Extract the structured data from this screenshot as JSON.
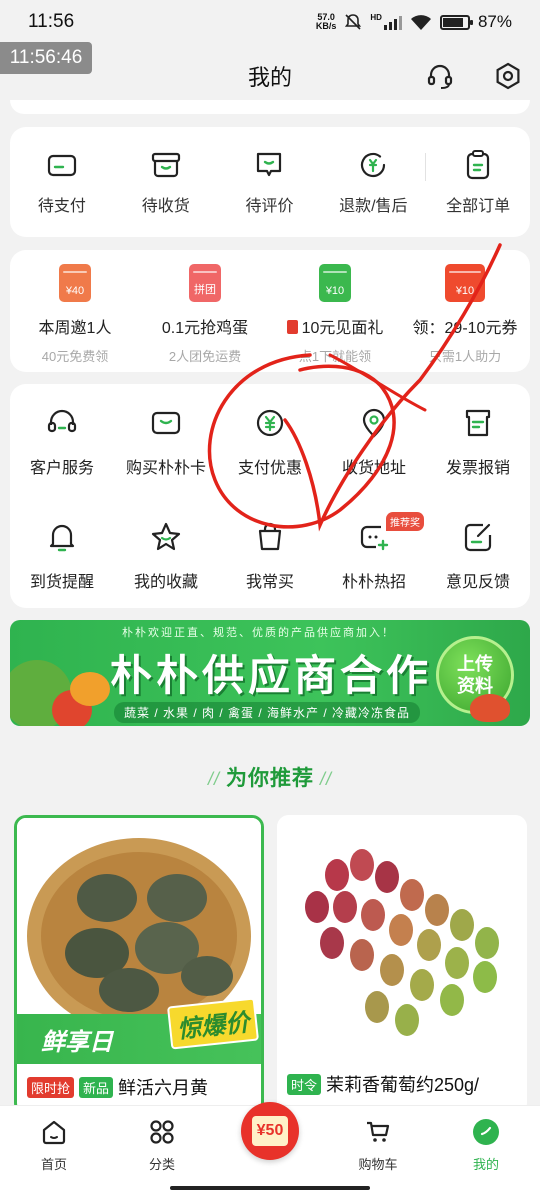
{
  "status_bar": {
    "time": "11:56",
    "net_speed_value": "57.0",
    "net_speed_unit": "KB/s",
    "network": "HD",
    "battery": "87%"
  },
  "clock_badge": "11:56:46",
  "header": {
    "title": "我的"
  },
  "orders": [
    {
      "label": "待支付",
      "icon": "card-icon"
    },
    {
      "label": "待收货",
      "icon": "box-icon"
    },
    {
      "label": "待评价",
      "icon": "chat-icon"
    },
    {
      "label": "退款/售后",
      "icon": "refund-icon"
    },
    {
      "label": "全部订单",
      "icon": "clipboard-icon"
    }
  ],
  "promos": [
    {
      "badge": "¥40",
      "title": "本周邀1人",
      "sub": "40元免费领",
      "color": "#f07a4a"
    },
    {
      "badge": "拼团",
      "title": "0.1元抢鸡蛋",
      "sub": "2人团免运费",
      "color": "#f06767"
    },
    {
      "badge": "¥10",
      "title": "10元见面礼",
      "sub": "点1下就能领",
      "color": "#3bb84e"
    },
    {
      "badge": "¥10",
      "title": "领：29-10元券",
      "sub": "只需1人助力",
      "color": "#ef4a2e"
    }
  ],
  "services_row1": [
    {
      "label": "客户服务",
      "icon": "headset-icon"
    },
    {
      "label": "购买朴朴卡",
      "icon": "card-icon"
    },
    {
      "label": "支付优惠",
      "icon": "yuan-icon"
    },
    {
      "label": "收货地址",
      "icon": "location-icon"
    },
    {
      "label": "发票报销",
      "icon": "invoice-icon"
    }
  ],
  "services_row2": [
    {
      "label": "到货提醒",
      "icon": "bell-icon"
    },
    {
      "label": "我的收藏",
      "icon": "star-icon"
    },
    {
      "label": "我常买",
      "icon": "bag-icon"
    },
    {
      "label": "朴朴热招",
      "icon": "recruit-icon",
      "badge": "推荐奖"
    },
    {
      "label": "意见反馈",
      "icon": "feedback-icon"
    }
  ],
  "banner": {
    "tagline": "朴朴欢迎正直、规范、优质的产品供应商加入！",
    "title": "朴朴供应商合作",
    "categories": "蔬菜 / 水果 / 肉 / 禽蛋 / 海鲜水产 / 冷藏冷冻食品",
    "cta_line1": "上传",
    "cta_line2": "资料"
  },
  "recommend": {
    "title": "为你推荐"
  },
  "products": [
    {
      "tag1": "限时抢",
      "tag2": "新品",
      "name": "鲜活六月黄",
      "overlay": "鲜享日",
      "promo": "惊爆价"
    },
    {
      "tag1": "时令",
      "name": "茉莉香葡萄约250g/"
    }
  ],
  "bottom_nav": [
    {
      "label": "首页",
      "icon": "home-icon"
    },
    {
      "label": "分类",
      "icon": "grid-icon"
    },
    {
      "label": "",
      "icon": "coupon-icon",
      "badge": "¥50"
    },
    {
      "label": "购物车",
      "icon": "cart-icon"
    },
    {
      "label": "我的",
      "icon": "profile-icon"
    }
  ]
}
